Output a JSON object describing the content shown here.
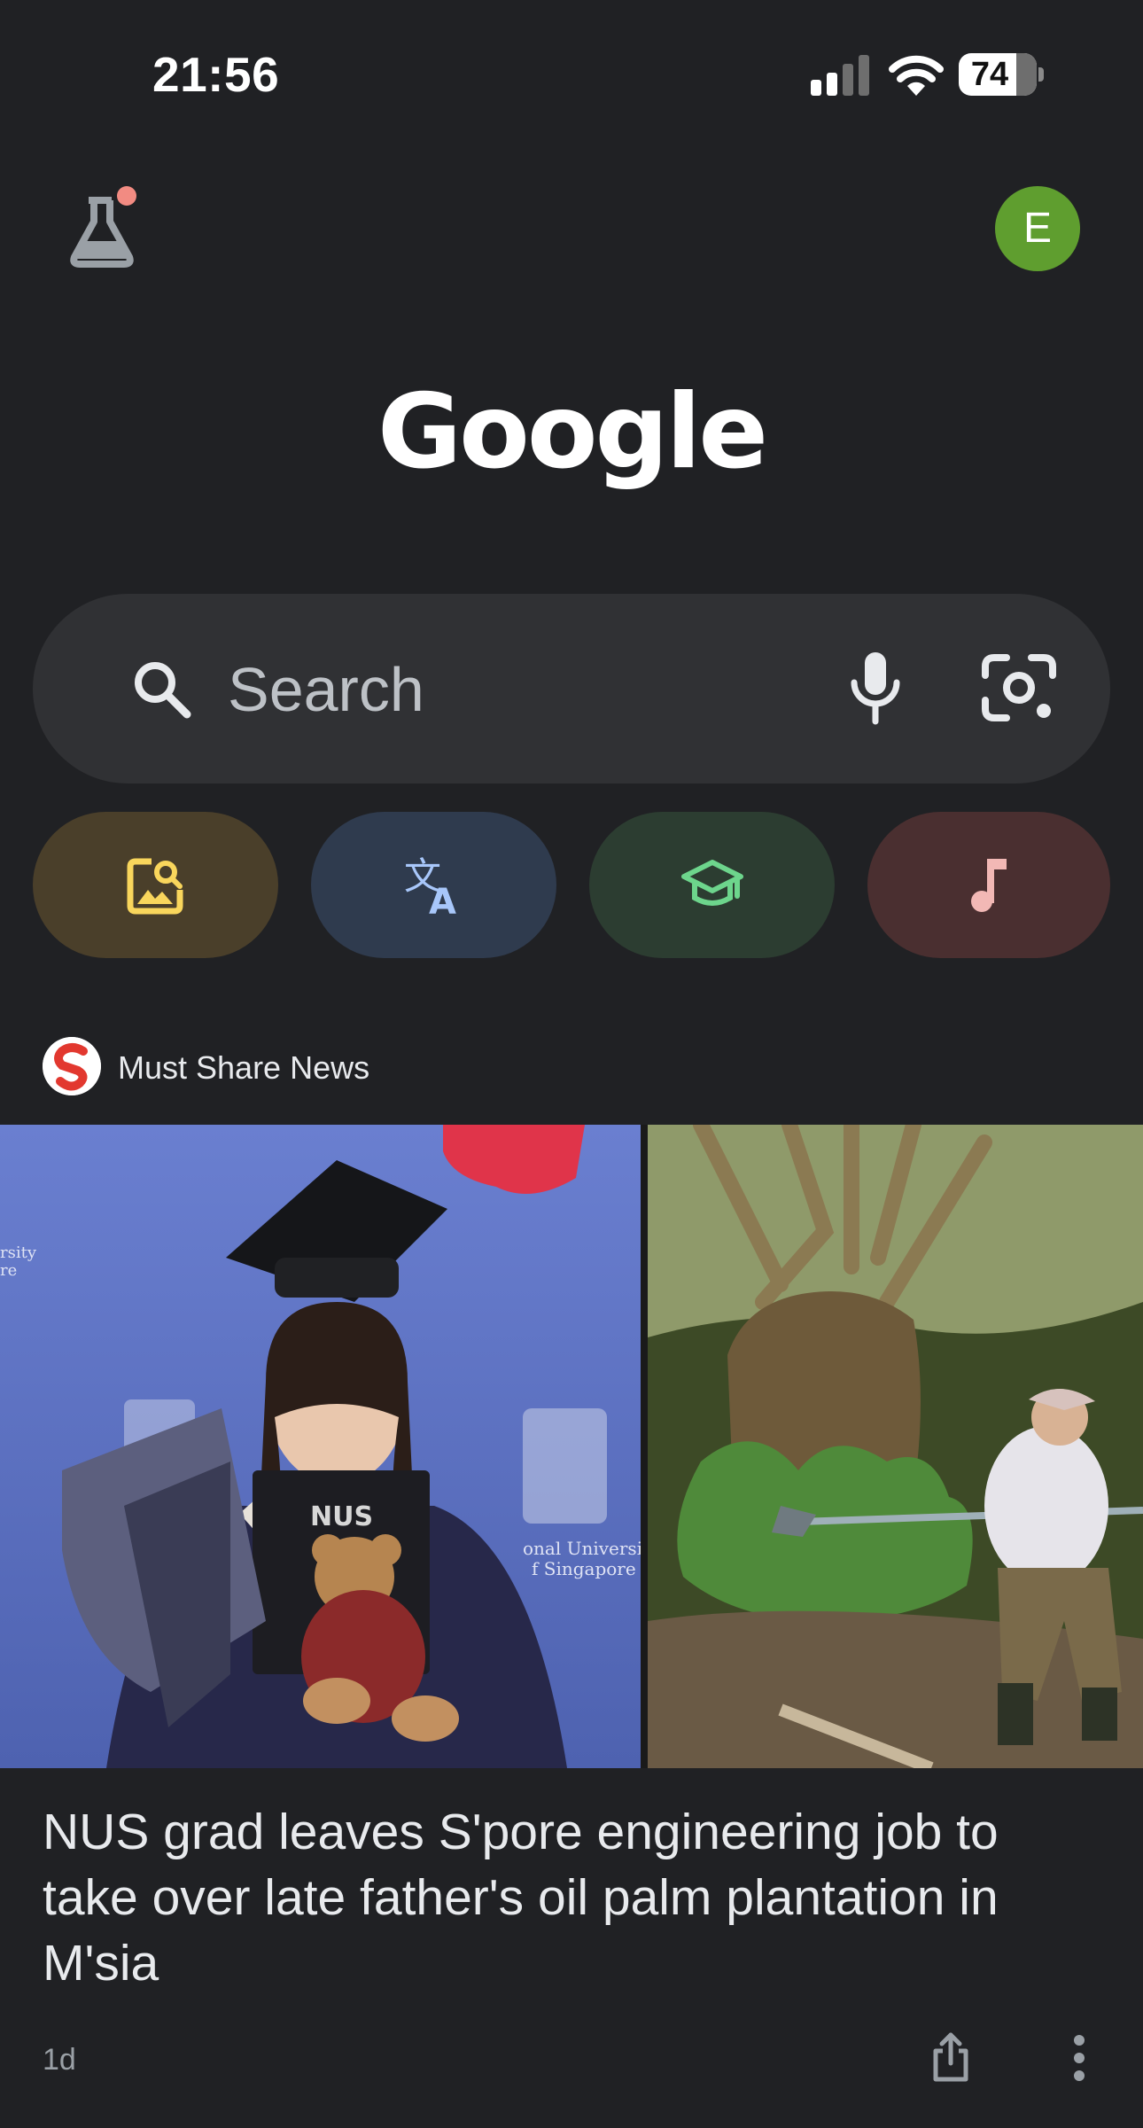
{
  "status_bar": {
    "time": "21:56",
    "battery": "74",
    "battery_fraction": 0.74,
    "icons": [
      "signal-icon",
      "wifi-icon",
      "battery-icon"
    ]
  },
  "header": {
    "labs_icon": "flask-icon",
    "avatar_letter": "E",
    "avatar_color": "#5f9e2f"
  },
  "logo": "Google",
  "search": {
    "placeholder": "Search",
    "icons": [
      "search-icon",
      "mic-icon",
      "lens-icon"
    ]
  },
  "chips": [
    {
      "icon": "image-search-icon",
      "background": "#4a3f2a",
      "color": "#f9d65c"
    },
    {
      "icon": "translate-icon",
      "background": "#2f3b4e",
      "color": "#a8c7fa"
    },
    {
      "icon": "graduation-cap-icon",
      "background": "#2c3d31",
      "color": "#6dd58c"
    },
    {
      "icon": "music-note-icon",
      "background": "#4a2f30",
      "color": "#f2b8b5"
    }
  ],
  "news": {
    "source": "Must Share News",
    "headline": "NUS grad leaves S'pore engineering job to take over late father's oil palm plantation in M'sia",
    "age": "1d",
    "image_text": {
      "gown_badge": "NUS",
      "backdrop": "onal University\nf Singapore",
      "backdrop_left": "rsity\nre"
    }
  },
  "colors": {
    "background": "#202124",
    "search_bar": "#303134",
    "text_primary": "#e8eaed",
    "text_secondary": "#9aa0a6"
  }
}
